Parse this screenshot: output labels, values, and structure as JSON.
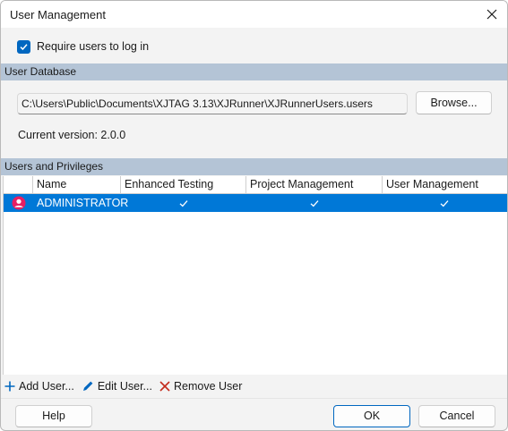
{
  "window": {
    "title": "User Management"
  },
  "login": {
    "label": "Require users to log in",
    "checked": true
  },
  "user_database": {
    "section_title": "User Database",
    "path": "C:\\Users\\Public\\Documents\\XJTAG 3.13\\XJRunner\\XJRunnerUsers.users",
    "browse_label": "Browse...",
    "version_text": "Current version: 2.0.0"
  },
  "privileges": {
    "section_title": "Users and Privileges",
    "columns": [
      "",
      "Name",
      "Enhanced Testing",
      "Project Management",
      "User Management"
    ],
    "rows": [
      {
        "icon": "user-icon",
        "name": "ADMINISTRATOR",
        "enhanced_testing": true,
        "project_management": true,
        "user_management": true
      }
    ]
  },
  "toolbar": {
    "add_label": "Add User...",
    "edit_label": "Edit User...",
    "remove_label": "Remove User"
  },
  "footer": {
    "help_label": "Help",
    "ok_label": "OK",
    "cancel_label": "Cancel"
  },
  "colors": {
    "accent": "#0078d7",
    "section": "#b4c4d6",
    "remove": "#c42b1c"
  }
}
